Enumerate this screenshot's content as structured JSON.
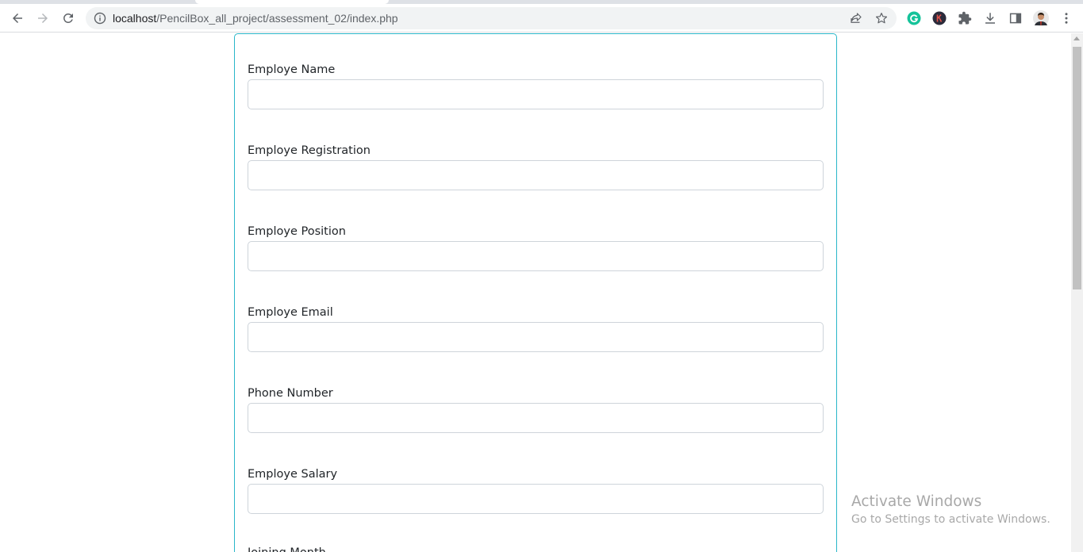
{
  "browser": {
    "url_host": "localhost",
    "url_path": "/PencilBox_all_project/assessment_02/index.php"
  },
  "form": {
    "fields": [
      {
        "label": "Employe Name",
        "value": ""
      },
      {
        "label": "Employe Registration",
        "value": ""
      },
      {
        "label": "Employe Position",
        "value": ""
      },
      {
        "label": "Employe Email",
        "value": ""
      },
      {
        "label": "Phone Number",
        "value": ""
      },
      {
        "label": "Employe Salary",
        "value": ""
      },
      {
        "label": "Joining Month",
        "value": ""
      }
    ]
  },
  "watermark": {
    "title": "Activate Windows",
    "subtitle": "Go to Settings to activate Windows."
  },
  "colors": {
    "card_border": "#29b6c9",
    "input_border": "#ced4da",
    "label_text": "#212529"
  }
}
